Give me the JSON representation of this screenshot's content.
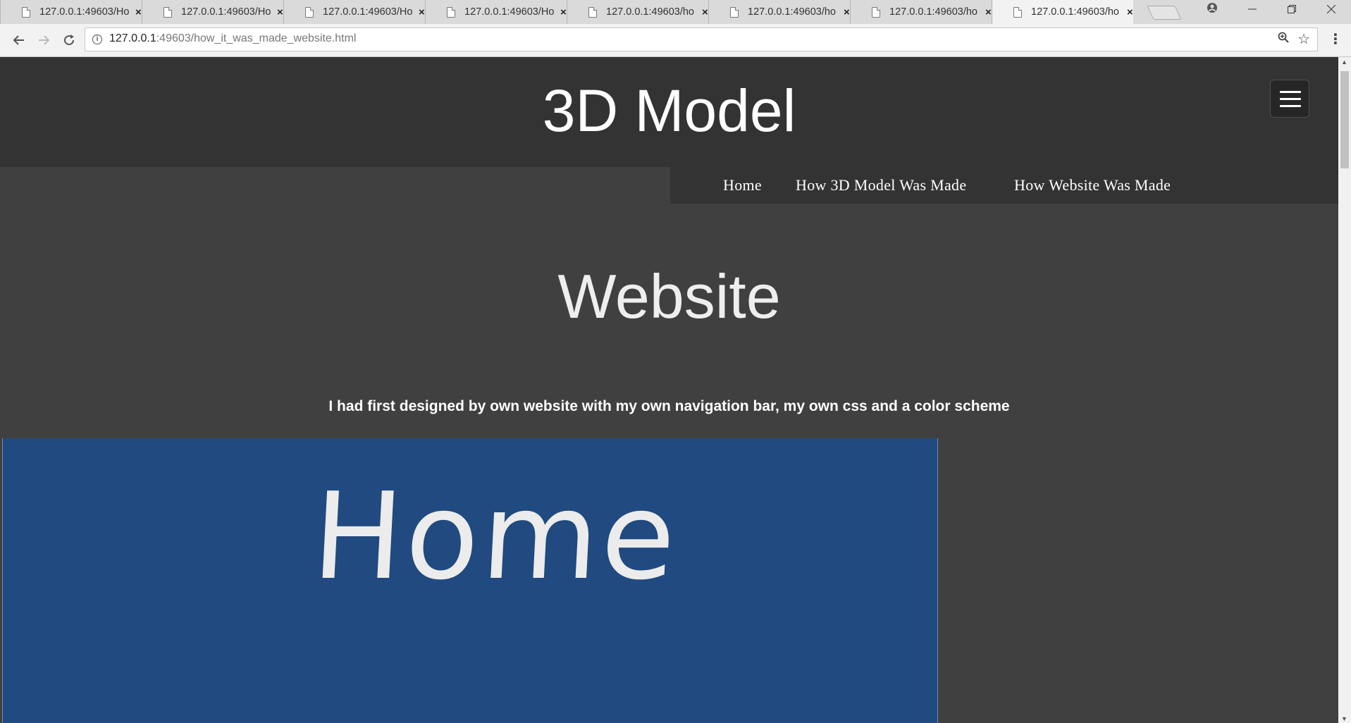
{
  "browser": {
    "tabs": [
      {
        "title": "127.0.0.1:49603/Ho",
        "close": "×"
      },
      {
        "title": "127.0.0.1:49603/Ho",
        "close": "×"
      },
      {
        "title": "127.0.0.1:49603/Ho",
        "close": "×"
      },
      {
        "title": "127.0.0.1:49603/Ho",
        "close": "×"
      },
      {
        "title": "127.0.0.1:49603/ho",
        "close": "×"
      },
      {
        "title": "127.0.0.1:49603/ho",
        "close": "×"
      },
      {
        "title": "127.0.0.1:49603/ho",
        "close": "×"
      },
      {
        "title": "127.0.0.1:49603/ho",
        "close": "×"
      }
    ],
    "active_tab_index": 7,
    "address": {
      "host": "127.0.0.1",
      "rest": ":49603/how_it_was_made_website.html"
    },
    "icons": {
      "back": "back-arrow-icon",
      "forward": "forward-arrow-icon",
      "reload": "reload-icon",
      "info": "info-icon",
      "zoom": "zoom-icon",
      "bookmark": "star-icon",
      "menu": "menu-dots-icon",
      "profile": "profile-icon"
    }
  },
  "site": {
    "title": "3D Model",
    "nav": [
      {
        "label": "Home"
      },
      {
        "label": "How 3D Model Was Made"
      },
      {
        "label": "How Website Was Made"
      }
    ],
    "heading": "Website",
    "intro": "I had first designed by own website with my own navigation bar, my own css and a color scheme",
    "image": {
      "caption_text": "Home",
      "background": "#204a80"
    },
    "colors": {
      "header": "#333333",
      "body": "#404040",
      "text": "#ffffff"
    }
  }
}
